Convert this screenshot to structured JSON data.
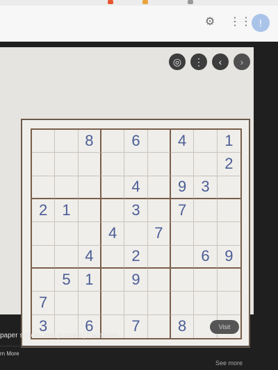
{
  "browser": {
    "icons": [
      "gear-icon",
      "apps-grid-icon"
    ],
    "avatar_initial": "!"
  },
  "viewer": {
    "controls": [
      "lens-icon",
      "more-icon",
      "prev-icon",
      "next-icon"
    ]
  },
  "sudoku": {
    "grid": [
      [
        "",
        "",
        "8",
        "",
        "6",
        "",
        "4",
        "",
        "1"
      ],
      [
        "",
        "",
        "",
        "",
        "",
        "",
        "",
        "",
        "2"
      ],
      [
        "",
        "",
        "",
        "",
        "4",
        "",
        "9",
        "3",
        ""
      ],
      [
        "2",
        "1",
        "",
        "",
        "3",
        "",
        "7",
        "",
        ""
      ],
      [
        "",
        "",
        "",
        "4",
        "",
        "7",
        "",
        "",
        ""
      ],
      [
        "",
        "",
        "4",
        "",
        "2",
        "",
        "",
        "6",
        "9"
      ],
      [
        "",
        "5",
        "1",
        "",
        "9",
        "",
        "",
        "",
        ""
      ],
      [
        "7",
        "",
        "",
        "",
        "",
        "",
        "",
        "",
        ""
      ],
      [
        "3",
        "",
        "6",
        "",
        "7",
        "",
        "8",
        "",
        ""
      ]
    ]
  },
  "result": {
    "title": "paper sudoku and puzzles | Facebook",
    "learn_more": "rn More",
    "visit_label": "Visit",
    "see_more": "See more"
  },
  "colors": {
    "digit": "#4c5d96",
    "grid_line": "#7a5e4b",
    "paper": "#efeeea"
  }
}
